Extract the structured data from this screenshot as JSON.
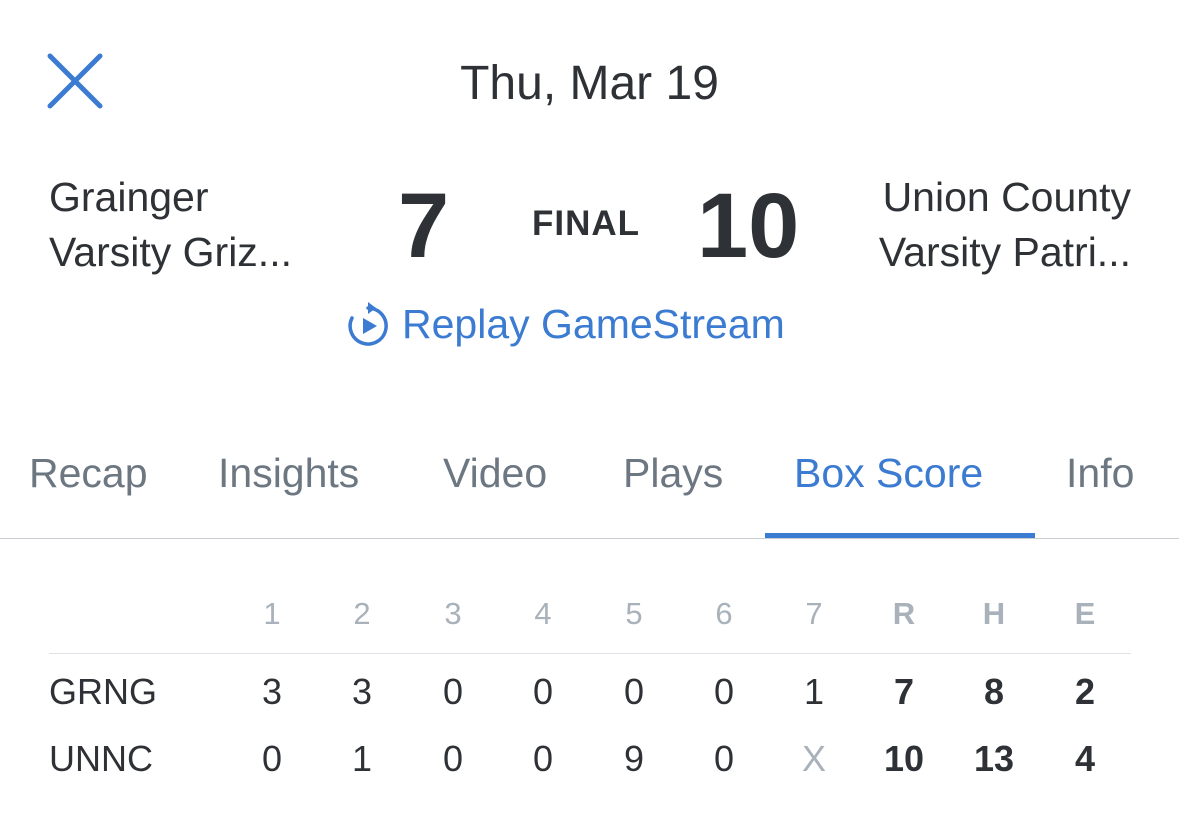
{
  "header": {
    "close_icon": "close-icon",
    "date": "Thu, Mar 19"
  },
  "game": {
    "away": {
      "name_line1": "Grainger",
      "name_line2": "Varsity Griz...",
      "score": "7"
    },
    "status": "FINAL",
    "home": {
      "score": "10",
      "name_line1": "Union County",
      "name_line2": "Varsity Patri..."
    },
    "replay": {
      "icon": "replay-icon",
      "label": "Replay GameStream"
    }
  },
  "tabs": [
    {
      "label": "Recap"
    },
    {
      "label": "Insights"
    },
    {
      "label": "Video"
    },
    {
      "label": "Plays"
    },
    {
      "label": "Box Score",
      "active": true
    },
    {
      "label": "Info"
    }
  ],
  "box_score": {
    "headers": [
      "1",
      "2",
      "3",
      "4",
      "5",
      "6",
      "7",
      "R",
      "H",
      "E"
    ],
    "rows": [
      {
        "team": "GRNG",
        "innings": [
          "3",
          "3",
          "0",
          "0",
          "0",
          "0",
          "1"
        ],
        "R": "7",
        "H": "8",
        "E": "2"
      },
      {
        "team": "UNNC",
        "innings": [
          "0",
          "1",
          "0",
          "0",
          "9",
          "0",
          "X"
        ],
        "R": "10",
        "H": "13",
        "E": "4"
      }
    ]
  },
  "colors": {
    "accent": "#3b7bd1",
    "text": "#2e3135",
    "muted": "#a9b1ba",
    "tab_inactive": "#6d7782"
  }
}
